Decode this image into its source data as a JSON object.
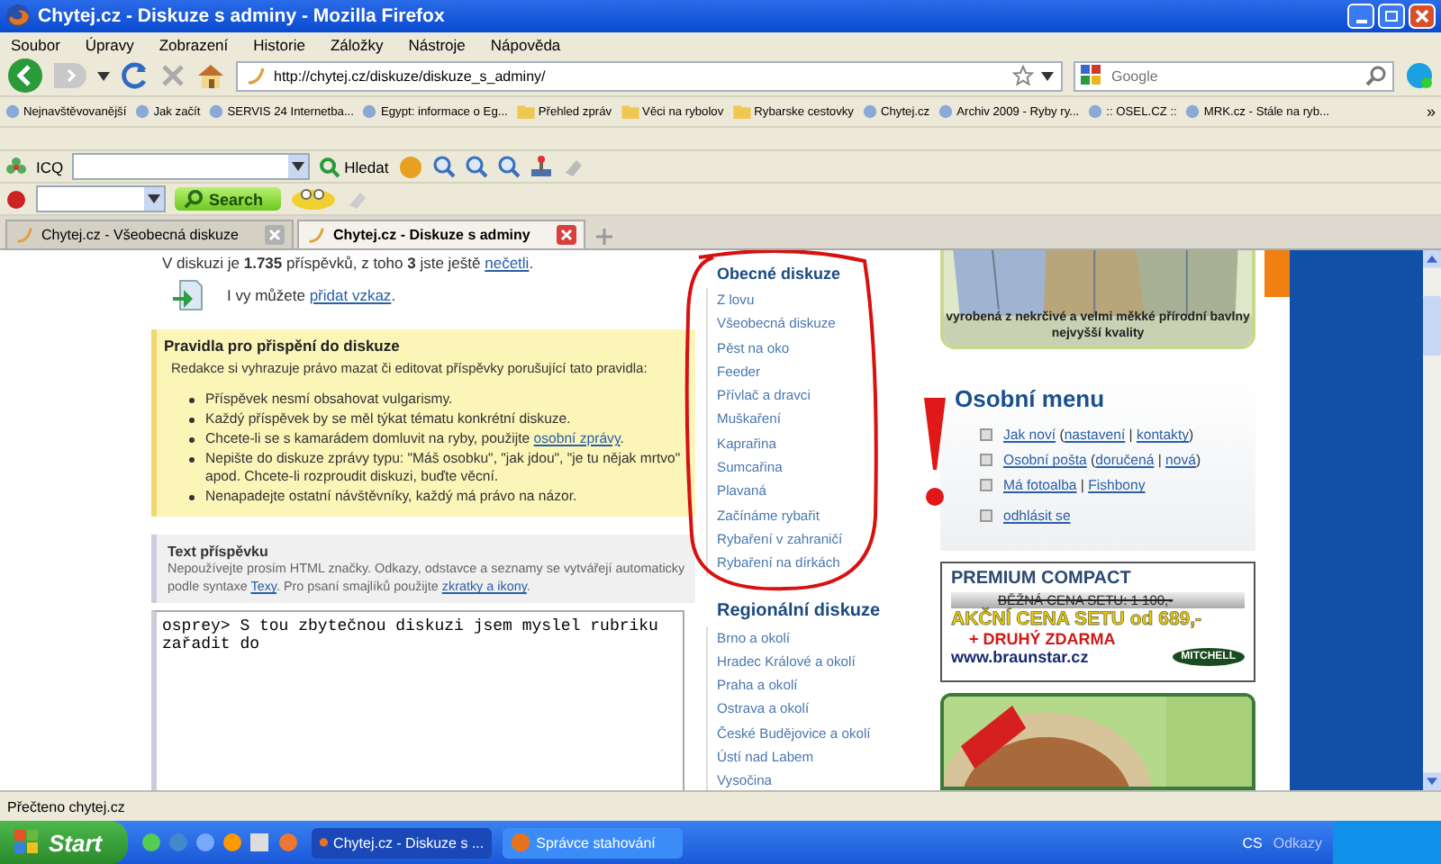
{
  "window": {
    "title": "Chytej.cz - Diskuze s adminy - Mozilla Firefox"
  },
  "menu": [
    "Soubor",
    "Úpravy",
    "Zobrazení",
    "Historie",
    "Záložky",
    "Nástroje",
    "Nápověda"
  ],
  "address": {
    "value": "http://chytej.cz/diskuze/diskuze_s_adminy/"
  },
  "web_search": {
    "placeholder": "Google"
  },
  "bookmarks": [
    {
      "label": "Nejnavštěvovanější",
      "kind": "page"
    },
    {
      "label": "Jak začít",
      "kind": "page"
    },
    {
      "label": "SERVIS 24 Internetba...",
      "kind": "page"
    },
    {
      "label": "Egypt: informace o Eg...",
      "kind": "page"
    },
    {
      "label": "Přehled zpráv",
      "kind": "folder"
    },
    {
      "label": "Věci na rybolov",
      "kind": "folder"
    },
    {
      "label": "Rybarske cestovky",
      "kind": "folder"
    },
    {
      "label": "Chytej.cz",
      "kind": "page"
    },
    {
      "label": "Archiv 2009 - Ryby ry...",
      "kind": "page"
    },
    {
      "label": ":: OSEL.CZ ::",
      "kind": "page"
    },
    {
      "label": "MRK.cz - Stále na ryb...",
      "kind": "page"
    }
  ],
  "bookmarks_more": "»",
  "icq_toolbar": {
    "label": "ICQ",
    "search_label": "Hledat"
  },
  "search_toolbar": {
    "button": "Search"
  },
  "tabs": [
    {
      "label": "Chytej.cz - Všeobecná diskuze",
      "selected": false
    },
    {
      "label": "Chytej.cz - Diskuze s adminy",
      "selected": true
    }
  ],
  "page": {
    "stats": [
      {
        "text": "V diskuzi je **1.735** příspěvků, z toho **3** jste ještě "
      },
      {
        "link": "nečetli"
      },
      {
        "text": "."
      }
    ],
    "add_post": [
      {
        "text": "I vy můžete "
      },
      {
        "link": "přidat vzkaz"
      },
      {
        "text": "."
      }
    ],
    "rules": {
      "title": "Pravidla pro přispění do diskuze",
      "intro": "Redakce si vyhrazuje právo mazat či editovat příspěvky porušující tato pravidla:",
      "items": [
        [
          {
            "text": "Příspěvek nesmí obsahovat vulgarismy."
          }
        ],
        [
          {
            "text": "Každý příspěvek by se měl týkat tématu konkrétní diskuze."
          }
        ],
        [
          {
            "text": "Chcete-li se s kamarádem domluvit na ryby, použijte "
          },
          {
            "link": "osobní zprávy"
          },
          {
            "text": "."
          }
        ],
        [
          {
            "text": "Nepište do diskuze zprávy typu: \"Máš osobku\", \"jak jdou\", \"je tu nějak mrtvo\" apod. Chcete-li rozproudit diskuzi, buďte věcní."
          }
        ],
        [
          {
            "text": "Nenapadejte ostatní návštěvníky, každý má právo na názor."
          }
        ]
      ]
    },
    "post_form": {
      "label": "Text příspěvku",
      "hint": [
        {
          "text": "Nepoužívejte prosím HTML značky. Odkazy, odstavce a seznamy se vytvářejí automaticky podle syntaxe "
        },
        {
          "link": "Texy"
        },
        {
          "text": ". Pro psaní smajlíků použijte "
        },
        {
          "link": "zkratky a ikony"
        },
        {
          "text": "."
        }
      ],
      "value": "osprey> S tou zbytečnou diskuzi jsem myslel rubriku zařadit do"
    },
    "general": {
      "title": "Obecné diskuze",
      "items": [
        "Z lovu",
        "Všeobecná diskuze",
        "Pěst na oko",
        "Feeder",
        "Přívlač a dravci",
        "Muškaření",
        "Kaprařina",
        "Sumcařina",
        "Plavaná",
        "Začínáme rybařit",
        "Rybaření v zahraničí",
        "Rybaření na dírkách"
      ]
    },
    "regional": {
      "title": "Regionální diskuze",
      "items": [
        "Brno a okolí",
        "Hradec Králové a okolí",
        "Praha a okolí",
        "Ostrava a okolí",
        "České Budějovice a okolí",
        "Ústí nad Labem",
        "Vysočina"
      ]
    },
    "shirt_ad": {
      "kind": "picture",
      "caption": "vyrobená z nekrčivé a velmi měkké přírodní bavlny nejvyšší kvality"
    },
    "personal_menu": {
      "title": "Osobní menu",
      "items": [
        [
          {
            "link": "Jak noví"
          },
          {
            "text": " ("
          },
          {
            "link": "nastavení"
          },
          {
            "text": " | "
          },
          {
            "link": "kontakty"
          },
          {
            "text": ")"
          }
        ],
        [
          {
            "link": "Osobní pošta"
          },
          {
            "text": " ("
          },
          {
            "link": "doručená"
          },
          {
            "text": " | "
          },
          {
            "link": "nová"
          },
          {
            "text": ")"
          }
        ],
        [
          {
            "link": "Má fotoalba"
          },
          {
            "text": " | "
          },
          {
            "link": "Fishbony"
          }
        ],
        [
          {
            "link": "odhlásit se"
          }
        ]
      ]
    },
    "reel_ad": {
      "title": "PREMIUM COMPACT",
      "old_price": "BĚŽNÁ CENA SETU: 1 100,-",
      "price": "AKČNÍ CENA SETU od 689,-",
      "bonus": "+ DRUHÝ ZDARMA",
      "url": "www.braunstar.cz",
      "brand": "MITCHELL"
    }
  },
  "status_bar": "Přečteno chytej.cz",
  "taskbar": {
    "start": "Start",
    "tasks": [
      {
        "label": "Chytej.cz - Diskuze s ...",
        "selected": true
      },
      {
        "label": "Správce stahování",
        "selected": false
      }
    ],
    "language": "CS",
    "links": "Odkazy"
  }
}
